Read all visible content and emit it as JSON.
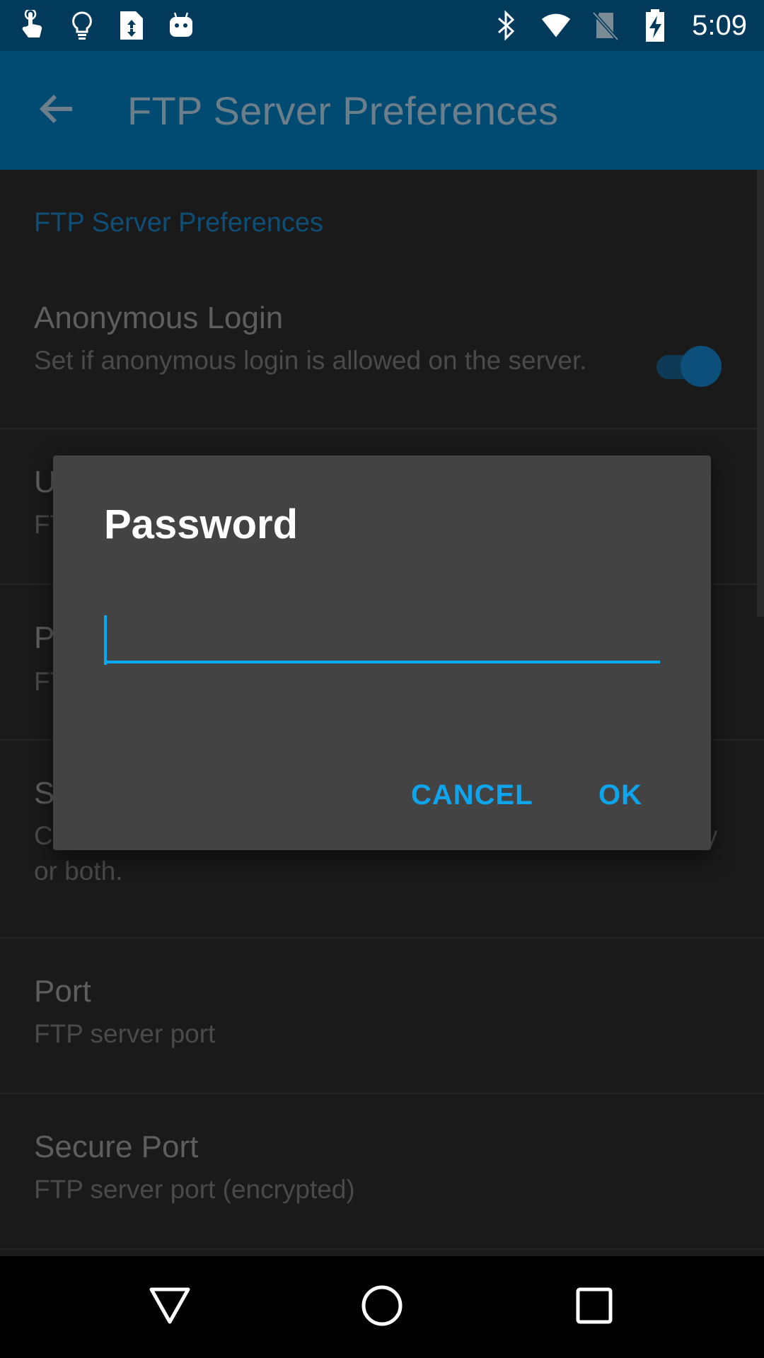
{
  "status_bar": {
    "time": "5:09",
    "left_icons": [
      "touch-gesture-icon",
      "lightbulb-icon",
      "file-transfer-icon",
      "android-icon"
    ],
    "right_icons": [
      "bluetooth-icon",
      "wifi-icon",
      "no-sim-icon",
      "battery-charging-icon"
    ]
  },
  "app_bar": {
    "title": "FTP Server Preferences",
    "back_icon": "arrow-back-icon"
  },
  "preferences": {
    "category": "FTP Server Preferences",
    "anonymous_login": {
      "title": "Anonymous Login",
      "summary": "Set if anonymous login is allowed on the server.",
      "enabled": true
    },
    "username": {
      "title_visible": "U",
      "summary_visible": "FT"
    },
    "password": {
      "title_visible": "P",
      "summary_visible": "FT"
    },
    "server_type": {
      "title_visible": "S",
      "summary": "Choose whether to start FTP server only, SFTP server only or both."
    },
    "port": {
      "title": "Port",
      "summary": "FTP server port"
    },
    "secure_port": {
      "title": "Secure Port",
      "summary": "FTP server port (encrypted)"
    }
  },
  "dialog": {
    "title": "Password",
    "input_value": "",
    "cancel_label": "CANCEL",
    "ok_label": "OK"
  },
  "colors": {
    "status_bar": "#013a5b",
    "app_bar": "#014a72",
    "accent": "#03a9f4",
    "dialog_bg": "#434343"
  },
  "nav_bar": {
    "icons": [
      "back-triangle-icon",
      "home-circle-icon",
      "recents-square-icon"
    ]
  }
}
